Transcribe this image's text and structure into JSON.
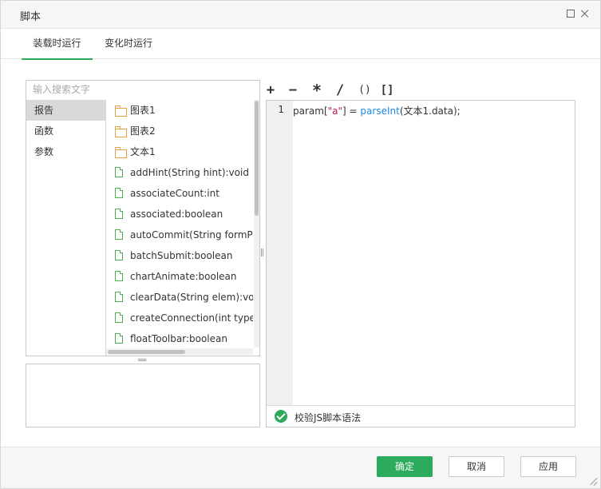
{
  "dialog": {
    "title": "脚本"
  },
  "tabs": [
    {
      "label": "装载时运行",
      "active": true
    },
    {
      "label": "变化时运行",
      "active": false
    }
  ],
  "search": {
    "placeholder": "输入搜索文字",
    "value": ""
  },
  "categories": [
    {
      "label": "报告",
      "selected": true
    },
    {
      "label": "函数",
      "selected": false
    },
    {
      "label": "参数",
      "selected": false
    }
  ],
  "items": [
    {
      "label": "图表1",
      "icon": "folder-icon"
    },
    {
      "label": "图表2",
      "icon": "folder-icon"
    },
    {
      "label": "文本1",
      "icon": "folder-icon"
    },
    {
      "label": "addHint(String hint):void",
      "icon": "file-icon"
    },
    {
      "label": "associateCount:int",
      "icon": "file-icon"
    },
    {
      "label": "associated:boolean",
      "icon": "file-icon"
    },
    {
      "label": "autoCommit(String formParm",
      "icon": "file-icon"
    },
    {
      "label": "batchSubmit:boolean",
      "icon": "file-icon"
    },
    {
      "label": "chartAnimate:boolean",
      "icon": "file-icon"
    },
    {
      "label": "clearData(String elem):void",
      "icon": "file-icon"
    },
    {
      "label": "createConnection(int type,Str",
      "icon": "file-icon"
    },
    {
      "label": "floatToolbar:boolean",
      "icon": "file-icon"
    }
  ],
  "operators": {
    "plus": "+",
    "minus": "−",
    "times": "*",
    "divide": "/",
    "paren": "()",
    "bracket": "[]"
  },
  "editor": {
    "line_number": "1",
    "code": {
      "t1": "param[",
      "t2": "\"a\"",
      "t3": "] = ",
      "t4": "parseInt",
      "t5": "(文本1.data);"
    },
    "validate_label": "校验JS脚本语法"
  },
  "footer": {
    "ok": "确定",
    "cancel": "取消",
    "apply": "应用"
  },
  "colors": {
    "accent": "#2bab5b",
    "string": "#c2185b",
    "function": "#1e88e5",
    "folder": "#e7a14a"
  }
}
